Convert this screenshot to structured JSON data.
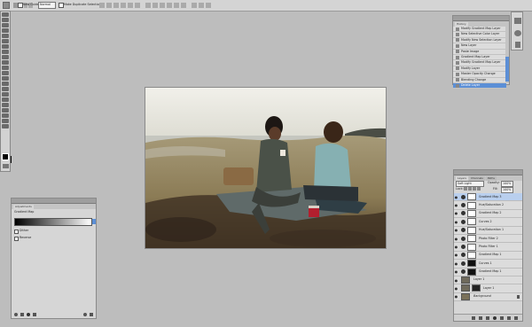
{
  "options_bar": {
    "checkbox1_label": "New Guide",
    "select_value": "Normal",
    "checkbox2_label": "Make Duplicate Selection"
  },
  "history_panel": {
    "tab_label": "History",
    "items": [
      "Modify Gradient Map Layer",
      "New Selective Color Layer",
      "Modify New Selection Layer",
      "New Layer",
      "Paste Image",
      "Gradient Map Layer",
      "Modify Gradient Map Layer",
      "Modify Layer",
      "Master Opacity Change",
      "Blending Change",
      "Delete Layer"
    ]
  },
  "adjustments_panel": {
    "tab_label": "Adjustments",
    "subtitle": "Gradient Map",
    "option1": "Dither",
    "option2": "Reverse"
  },
  "layers_panel": {
    "tabs": [
      "Layers",
      "Channels",
      "Paths"
    ],
    "blend_mode": "Soft Light",
    "opacity_label": "Opacity:",
    "opacity_value": "100%",
    "lock_label": "Lock:",
    "fill_label": "Fill:",
    "fill_value": "100%",
    "layers": [
      "Gradient Map 3",
      "Hue/Saturation 2",
      "Gradient Map 2",
      "Curves 2",
      "Hue/Saturation 1",
      "Photo Filter 2",
      "Photo Filter 1",
      "Gradient Map 1",
      "Curves 1",
      "Gradient Map 1",
      "Layer 1",
      "Layer 1",
      "Background"
    ]
  }
}
